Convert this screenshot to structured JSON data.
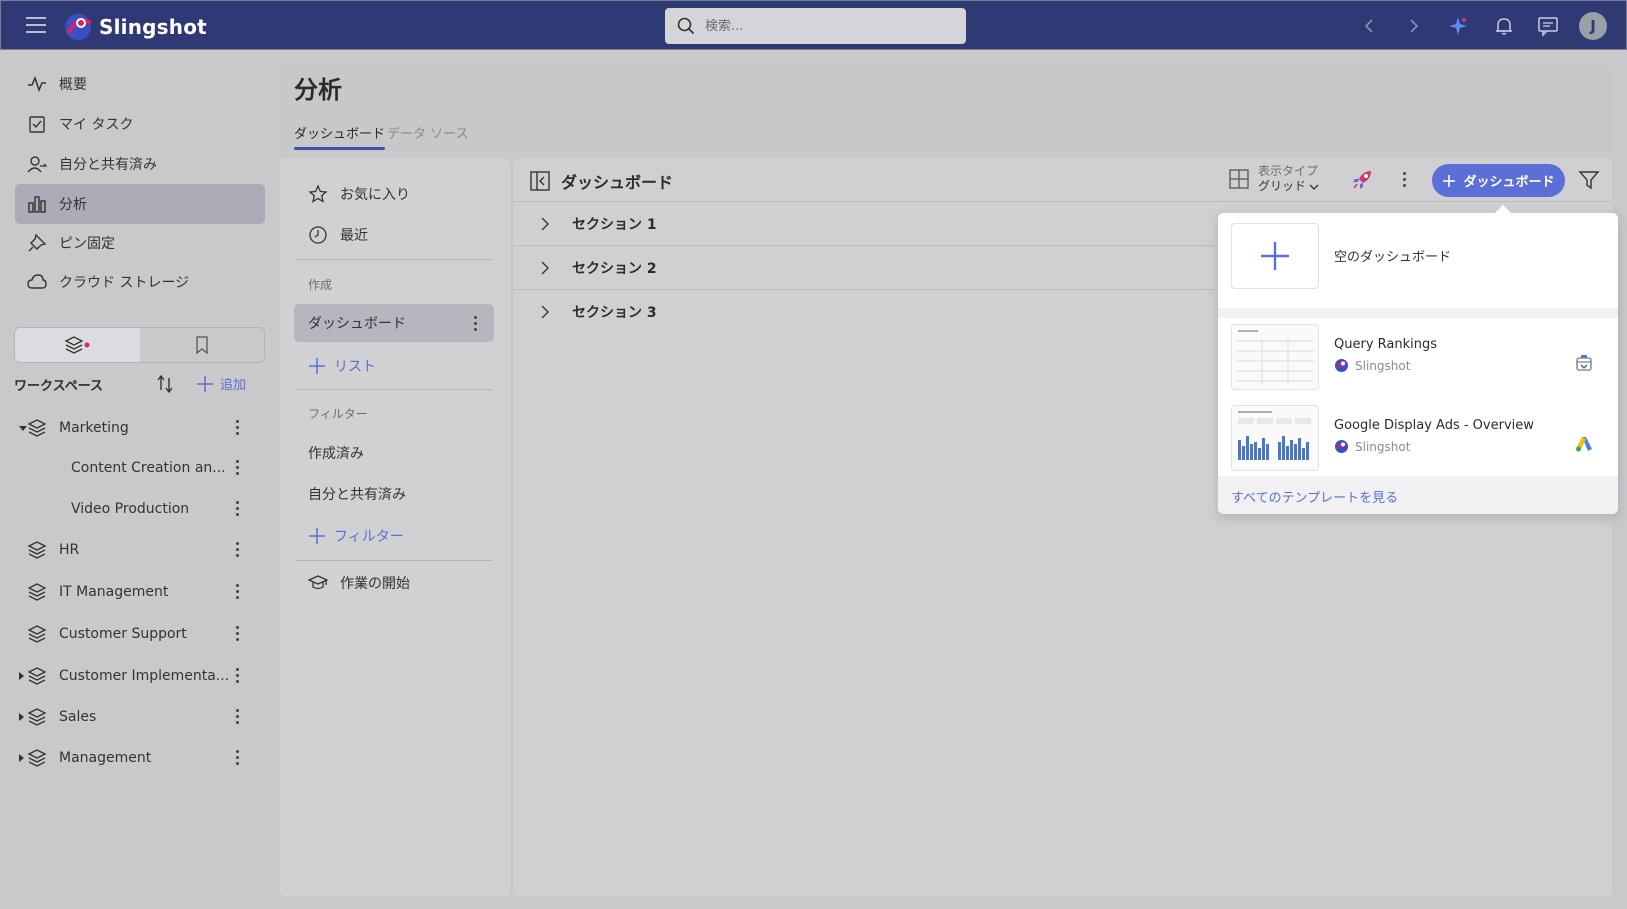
{
  "app": {
    "name": "Slingshot"
  },
  "search": {
    "placeholder": "検索..."
  },
  "user": {
    "initial": "J"
  },
  "nav": {
    "items": [
      {
        "label": "概要",
        "icon": "activity-icon"
      },
      {
        "label": "マイ タスク",
        "icon": "task-checkbox-icon"
      },
      {
        "label": "自分と共有済み",
        "icon": "shared-user-icon"
      },
      {
        "label": "分析",
        "icon": "bar-chart-icon",
        "active": true
      },
      {
        "label": "ピン固定",
        "icon": "pin-icon"
      },
      {
        "label": "クラウド ストレージ",
        "icon": "cloud-icon"
      }
    ]
  },
  "workspaces": {
    "title": "ワークスペース",
    "add_label": "追加",
    "items": [
      {
        "label": "Marketing",
        "expanded": true
      },
      {
        "label": "Content Creation an...",
        "sub": true
      },
      {
        "label": "Video Production",
        "sub": true
      },
      {
        "label": "HR"
      },
      {
        "label": "IT Management"
      },
      {
        "label": "Customer Support"
      },
      {
        "label": "Customer Implementa..."
      },
      {
        "label": "Sales"
      },
      {
        "label": "Management"
      }
    ]
  },
  "page": {
    "title": "分析",
    "tabs": [
      {
        "label": "ダッシュボード",
        "active": true
      },
      {
        "label": "データ ソース",
        "active": false
      }
    ]
  },
  "middle": {
    "favorites": "お気に入り",
    "recent": "最近",
    "create_caption": "作成",
    "dashboard_item": "ダッシュボード",
    "add_list": "リスト",
    "filter_caption": "フィルター",
    "created": "作成済み",
    "shared": "自分と共有済み",
    "add_filter": "フィルター",
    "getting_started": "作業の開始"
  },
  "right": {
    "title": "ダッシュボード",
    "view_type_label": "表示タイプ",
    "view_type_value": "グリッド",
    "new_dashboard_button": "ダッシュボード",
    "sections": [
      "セクション 1",
      "セクション 2",
      "セクション 3"
    ]
  },
  "popup": {
    "blank_label": "空のダッシュボード",
    "templates": [
      {
        "name": "Query Rankings",
        "source": "Slingshot",
        "brand_icon": "bigquery-icon"
      },
      {
        "name": "Google Display Ads - Overview",
        "source": "Slingshot",
        "brand_icon": "google-ads-icon"
      }
    ],
    "see_all": "すべてのテンプレートを見る"
  },
  "colors": {
    "topbar": "#2f3a74",
    "accent": "#5b6fd6",
    "link": "#5a6fcf"
  }
}
